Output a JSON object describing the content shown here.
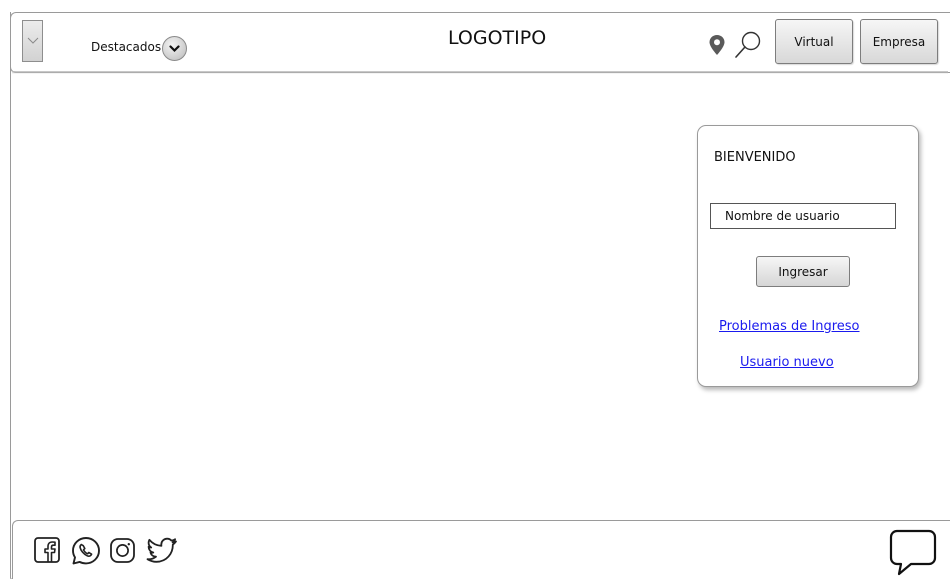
{
  "header": {
    "menu_icon": "chevron-down-icon",
    "featured_label": "Destacados",
    "featured_icon": "chevron-down-icon",
    "logo_text": "LOGOTIPO",
    "location_icon": "map-pin-icon",
    "search_icon": "search-icon",
    "virtual_label": "Virtual",
    "empresa_label": "Empresa"
  },
  "login": {
    "title": "BIENVENIDO",
    "username_placeholder": "Nombre de usuario",
    "submit_label": "Ingresar",
    "problems_link": "Problemas de Ingreso",
    "new_user_link": "Usuario nuevo"
  },
  "footer": {
    "social_icons": [
      "facebook-icon",
      "whatsapp-icon",
      "instagram-icon",
      "twitter-icon"
    ],
    "chat_icon": "chat-bubble-icon"
  },
  "colors": {
    "link": "#1a1aee",
    "border": "#9a9a9a",
    "button_top": "#f6f6f6",
    "button_bottom": "#d8d8d8"
  }
}
